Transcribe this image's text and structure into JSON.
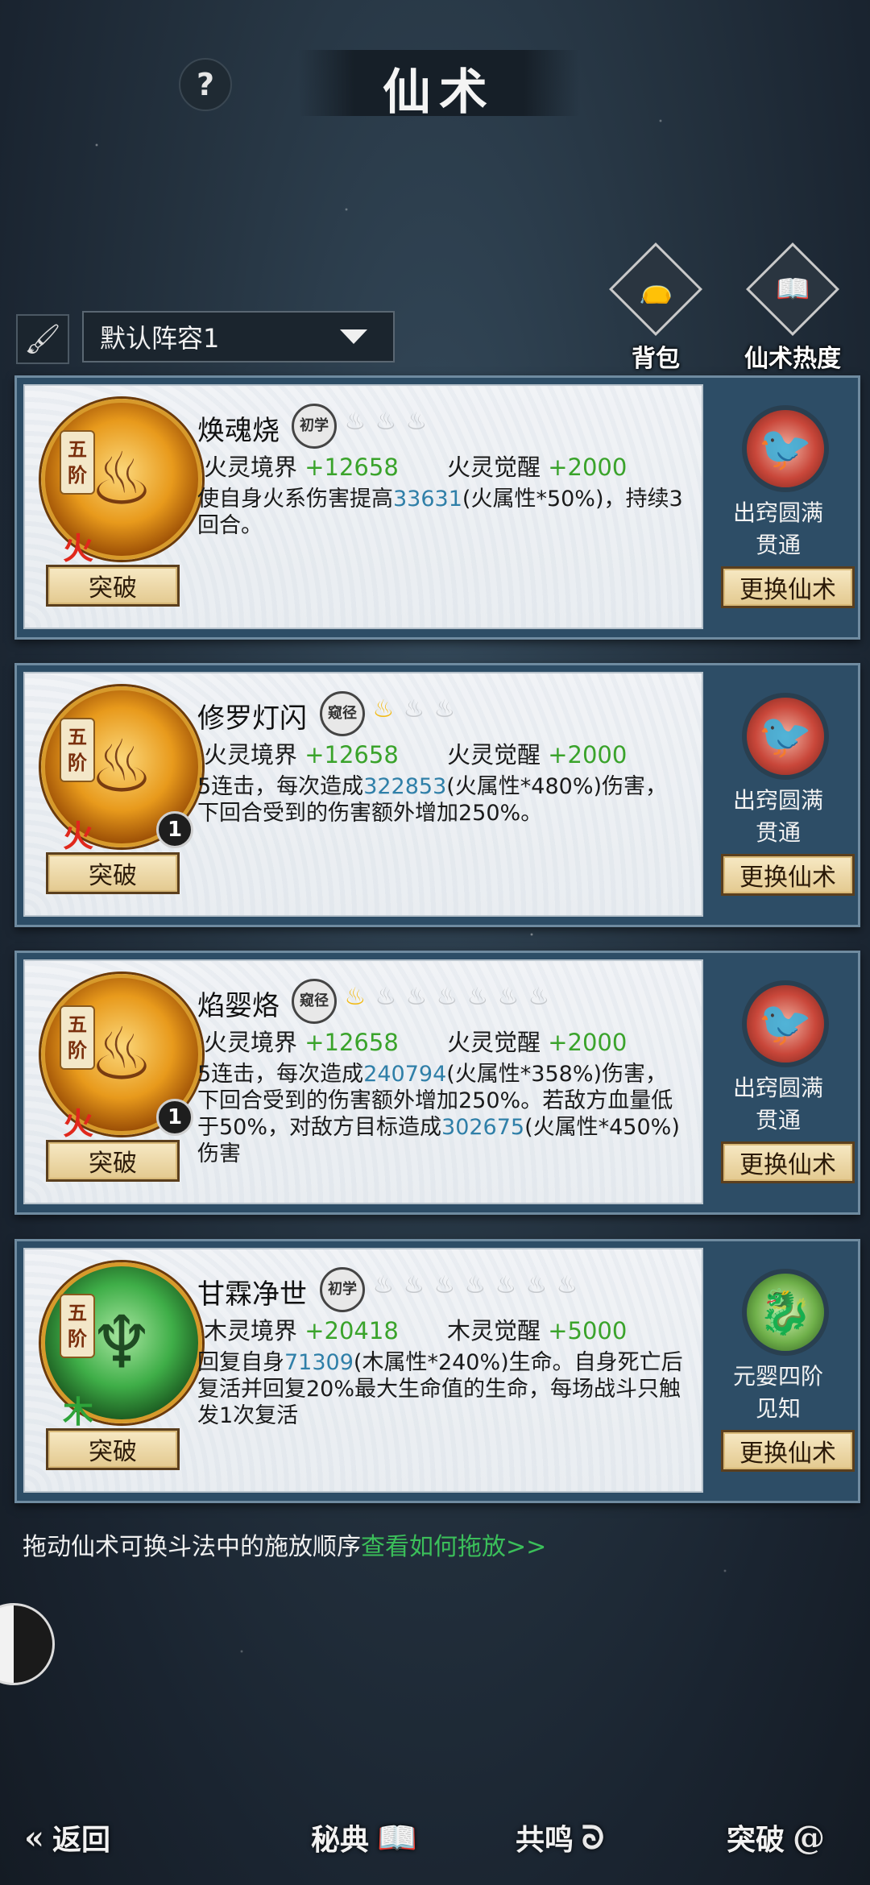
{
  "header": {
    "title": "仙术",
    "help_icon": "?"
  },
  "toolbar": {
    "lineup": "默认阵容1"
  },
  "top_buttons": [
    {
      "label": "背包",
      "icon": "bag-icon"
    },
    {
      "label": "仙术热度",
      "icon": "book-flame-icon"
    }
  ],
  "skills": [
    {
      "tier": [
        "五",
        "阶"
      ],
      "element": "火",
      "badge": "",
      "name": "焕魂烧",
      "rank": "初学",
      "flames_on": 0,
      "stat1_label": "火灵境界",
      "stat1_value": "+12658",
      "stat2_label": "火灵觉醒",
      "stat2_value": "+2000",
      "desc": [
        [
          "使自身火系伤害提高",
          ""
        ],
        [
          "33631",
          "n"
        ],
        [
          "(火属性*50%)，持续3回合。",
          ""
        ]
      ],
      "break_label": "突破",
      "pet_label_1": "出窍圆满",
      "pet_label_2": "贯通",
      "swap_label": "更换仙术"
    },
    {
      "tier": [
        "五",
        "阶"
      ],
      "element": "火",
      "badge": "1",
      "name": "修罗灯闪",
      "rank": "窥径",
      "flames_on": 1,
      "stat1_label": "火灵境界",
      "stat1_value": "+12658",
      "stat2_label": "火灵觉醒",
      "stat2_value": "+2000",
      "desc": [
        [
          "5连击，每次造成",
          ""
        ],
        [
          "322853",
          "n"
        ],
        [
          "(火属性*480%)伤害，下回合受到的伤害额外增加250%。",
          ""
        ]
      ],
      "break_label": "突破",
      "pet_label_1": "出窍圆满",
      "pet_label_2": "贯通",
      "swap_label": "更换仙术"
    },
    {
      "tier": [
        "五",
        "阶"
      ],
      "element": "火",
      "badge": "1",
      "name": "焰婴烙",
      "rank": "窥径",
      "flames_on": 1,
      "stat1_label": "火灵境界",
      "stat1_value": "+12658",
      "stat2_label": "火灵觉醒",
      "stat2_value": "+2000",
      "desc": [
        [
          "5连击，每次造成",
          ""
        ],
        [
          "240794",
          "n"
        ],
        [
          "(火属性*358%)伤害，下回合受到的伤害额外增加250%。若敌方血量低于50%，对敌方目标造成",
          ""
        ],
        [
          "302675",
          "n"
        ],
        [
          "(火属性*450%)伤害",
          ""
        ]
      ],
      "break_label": "突破",
      "pet_label_1": "出窍圆满",
      "pet_label_2": "贯通",
      "swap_label": "更换仙术"
    },
    {
      "tier": [
        "五",
        "阶"
      ],
      "element": "木",
      "badge": "",
      "name": "甘霖净世",
      "rank": "初学",
      "flames_on": 0,
      "stat1_label": "木灵境界",
      "stat1_value": "+20418",
      "stat2_label": "木灵觉醒",
      "stat2_value": "+5000",
      "desc": [
        [
          "回复自身",
          ""
        ],
        [
          "71309",
          "n"
        ],
        [
          "(木属性*240%)生命。自身死亡后复活并回复20%最大生命值的生命，每场战斗只触发1次复活",
          ""
        ]
      ],
      "break_label": "突破",
      "pet_label_1": "元婴四阶",
      "pet_label_2": "见知",
      "swap_label": "更换仙术"
    }
  ],
  "hint": {
    "text": "拖动仙术可换斗法中的施放顺序",
    "link": "查看如何拖放>>"
  },
  "bottom_nav": [
    {
      "label": "返回",
      "icon": "back-arrow-icon"
    },
    {
      "label": "秘典",
      "icon": "open-book-icon"
    },
    {
      "label": "共鸣",
      "icon": "swirl-icon"
    },
    {
      "label": "突破",
      "icon": "vortex-icon"
    }
  ],
  "colors": {
    "stat_value": "#3aa32b",
    "number_highlight": "#2f7fa8",
    "link": "#3bbf5a",
    "fire_element": "#e0281c",
    "wood_element": "#2ea43a"
  }
}
